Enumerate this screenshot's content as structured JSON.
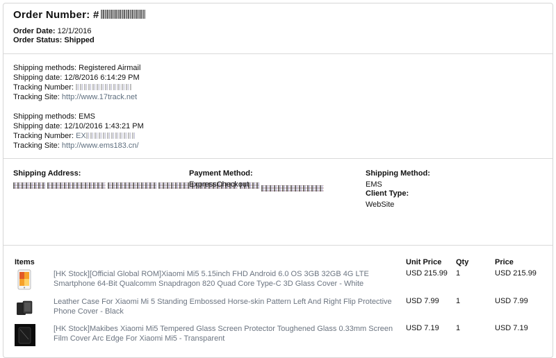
{
  "order": {
    "number_label": "Order Number: #",
    "date_label": "Order Date:",
    "date": "12/1/2016",
    "status_label": "Order Status:",
    "status": "Shipped"
  },
  "shipments": [
    {
      "method": "Shipping methods: Registered Airmail",
      "date": "Shipping date: 12/8/2016 6:14:29 PM",
      "tracking_label": "Tracking Number:",
      "tracking_prefix": "",
      "site_label": "Tracking Site:",
      "site_url": "http://www.17track.net"
    },
    {
      "method": "Shipping methods: EMS",
      "date": "Shipping date: 12/10/2016 1:43:21 PM",
      "tracking_label": "Tracking Number:",
      "tracking_prefix": "EX",
      "site_label": "Tracking Site:",
      "site_url": "http://www.ems183.cn/"
    }
  ],
  "details": {
    "shipping_address_label": "Shipping Address:",
    "payment_method_label": "Payment Method:",
    "payment_method": "ExpressCheckout",
    "shipping_method_label": "Shipping Method:",
    "shipping_method": "EMS",
    "client_type_label": "Client Type:",
    "client_type": "WebSite"
  },
  "items_table": {
    "headers": {
      "items": "Items",
      "unit_price": "Unit Price",
      "qty": "Qty",
      "price": "Price"
    },
    "rows": [
      {
        "icon": "phone-product-thumbnail",
        "description": "[HK Stock][Official Global ROM]Xiaomi Mi5 5.15inch FHD Android 6.0 OS 3GB 32GB 4G LTE Smartphone 64-Bit Qualcomm Snapdragon 820 Quad Core Type-C 3D Glass Cover - White",
        "unit_price": "USD 215.99",
        "qty": "1",
        "price": "USD 215.99"
      },
      {
        "icon": "phone-case-thumbnail",
        "description": "Leather Case For Xiaomi Mi 5 Standing Embossed Horse-skin Pattern Left And Right Flip Protective Phone Cover - Black",
        "unit_price": "USD 7.99",
        "qty": "1",
        "price": "USD 7.99"
      },
      {
        "icon": "screen-protector-thumbnail",
        "description": "[HK Stock]Makibes Xiaomi Mi5 Tempered Glass Screen Protector Toughened Glass 0.33mm Screen Film Cover Arc Edge For Xiaomi Mi5 - Transparent",
        "unit_price": "USD 7.19",
        "qty": "1",
        "price": "USD 7.19"
      }
    ]
  }
}
